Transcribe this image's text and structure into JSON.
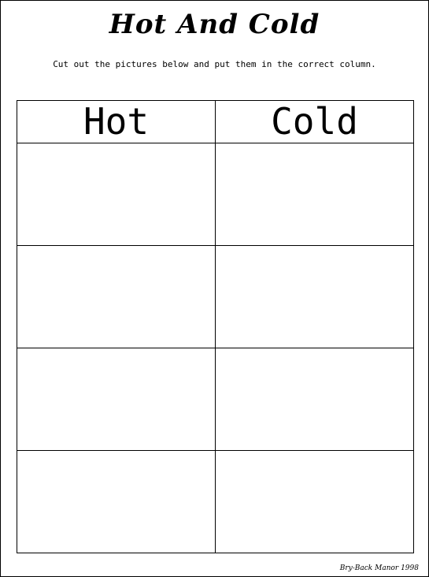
{
  "worksheet": {
    "title": "Hot And Cold",
    "instructions": "Cut out the pictures below and put them in the correct column.",
    "columns": [
      "Hot",
      "Cold"
    ],
    "credit": "Bry-Back Manor 1998"
  }
}
